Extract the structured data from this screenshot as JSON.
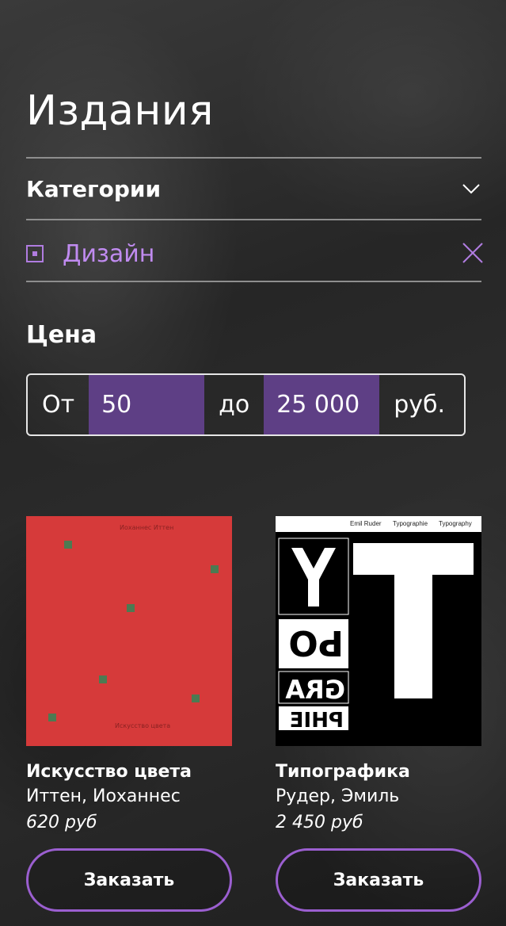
{
  "page": {
    "title": "Издания"
  },
  "categories": {
    "title": "Категории",
    "selected_filter": "Дизайн"
  },
  "price": {
    "title": "Цена",
    "from_label": "От",
    "from_value": "50",
    "to_label": "до",
    "to_value": "25 000",
    "currency": "руб."
  },
  "products": [
    {
      "title": "Искусство цвета",
      "author": "Иттен, Иоханнес",
      "price": "620 руб",
      "button": "Заказать",
      "cover_top_text": "Иоханнес Иттен",
      "cover_bottom_text": "Искусство цвета"
    },
    {
      "title": "Типографика",
      "author": "Рудер, Эмиль",
      "price": "2 450 руб",
      "button": "Заказать",
      "cover_header": [
        "Emil Ruder",
        "Typographie",
        "Typography"
      ]
    }
  ],
  "colors": {
    "accent": "#b07ce0",
    "input_bg": "#5e3f85",
    "button_border": "#9b5fd0"
  }
}
